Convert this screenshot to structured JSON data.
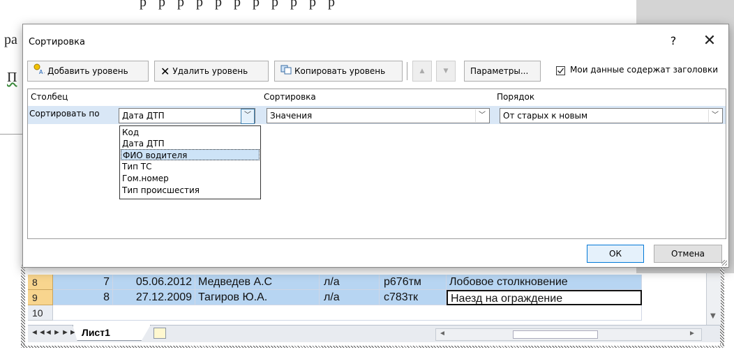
{
  "document": {
    "line1": "р  р      р   р  р  р  р  р  р  р  р",
    "line2_prefix": "ра",
    "line3_prefix": "П"
  },
  "dialog": {
    "title": "Сортировка",
    "help_label": "?",
    "close_label": "✕",
    "toolbar": {
      "add_level": "Добавить уровень",
      "delete_level": "Удалить уровень",
      "copy_level": "Копировать уровень",
      "move_up": "▲",
      "move_down": "▼",
      "options": "Параметры...",
      "headers_checkbox_label": "Мои данные содержат заголовки",
      "headers_checkbox_checked": true
    },
    "columns": {
      "column": "Столбец",
      "sort_on": "Сортировка",
      "order": "Порядок"
    },
    "level": {
      "label": "Сортировать по",
      "column_value": "Дата ДТП",
      "sort_on_value": "Значения",
      "order_value": "От старых к новым"
    },
    "column_options": [
      "Код",
      "Дата ДТП",
      "ФИО водителя",
      "Тип ТС",
      "Гом.номер",
      "Тип происшестия"
    ],
    "highlighted_option": "ФИО водителя",
    "ok": "ОК",
    "cancel": "Отмена"
  },
  "sheet": {
    "rows": [
      {
        "num": "8",
        "code": "7",
        "date": "05.06.2012",
        "driver": "Медведев А.С",
        "type": "л/а",
        "plate": "р676тм",
        "incident": "Лобовое столкновение"
      },
      {
        "num": "9",
        "code": "8",
        "date": "27.12.2009",
        "driver": "Тагиров Ю.А.",
        "type": "л/а",
        "plate": "с783тк",
        "incident": "Наезд на ограждение"
      }
    ],
    "empty_row_num": "10",
    "tab_name": "Лист1",
    "nav_first": "◄◄",
    "nav_prev": "◄",
    "nav_next": "►",
    "nav_last": "►►"
  },
  "colors": {
    "selection": "#b7d5f2",
    "row_header_selected": "#f8d58e",
    "level_row": "#d9e7f6",
    "ok_border": "#0078d7"
  }
}
